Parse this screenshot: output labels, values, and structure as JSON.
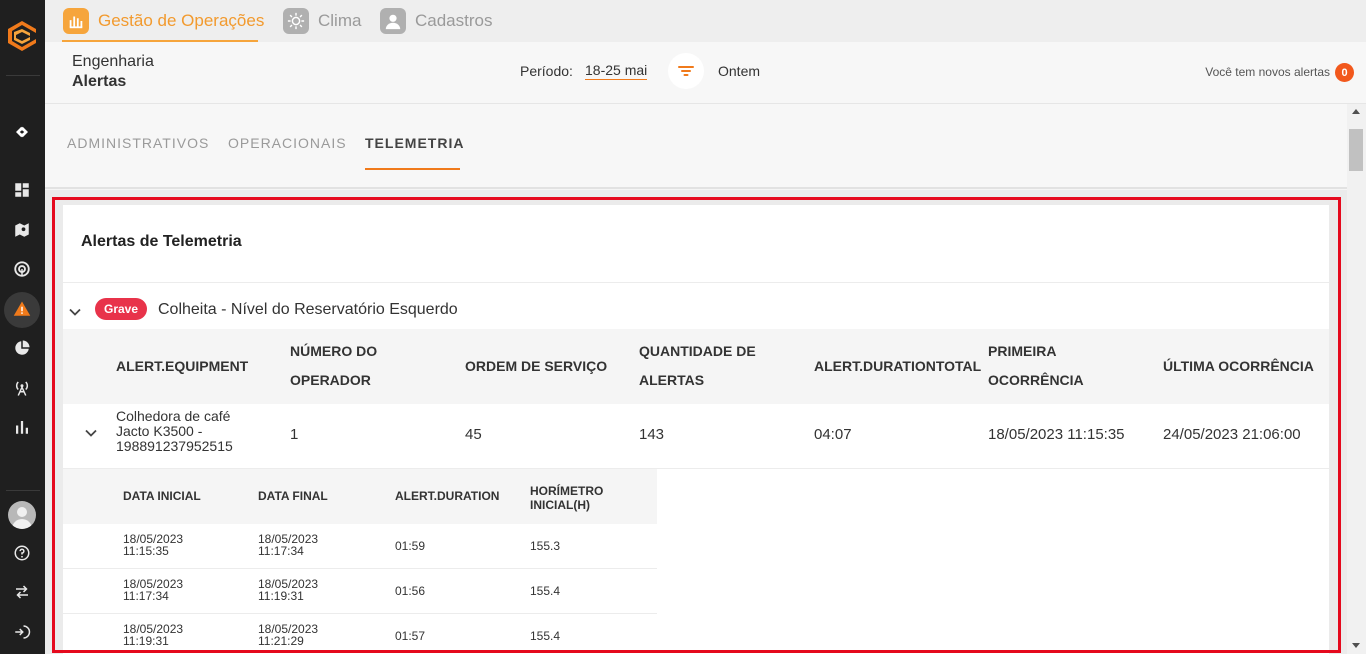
{
  "topnav": {
    "tabs": [
      {
        "label": "Gestão de Operações",
        "icon": "operations-icon",
        "active": true
      },
      {
        "label": "Clima",
        "icon": "sun-icon",
        "active": false
      },
      {
        "label": "Cadastros",
        "icon": "user-icon",
        "active": false
      }
    ]
  },
  "header": {
    "breadcrumb": "Engenharia",
    "title": "Alertas",
    "period_label": "Período:",
    "period_value": "18-25 mai",
    "filter_icon": "filter-icon",
    "quick_filter": "Ontem",
    "alerts_message": "Você tem novos alertas",
    "alerts_count": "0"
  },
  "subtabs": [
    "ADMINISTRATIVOS",
    "OPERACIONAIS",
    "TELEMETRIA"
  ],
  "card": {
    "title": "Alertas de Telemetria",
    "group": {
      "severity": "Grave",
      "title": "Colheita - Nível do Reservatório Esquerdo"
    },
    "columns": [
      "ALERT.EQUIPMENT",
      "NÚMERO DO OPERADOR",
      "ORDEM DE SERVIÇO",
      "QUANTIDADE DE ALERTAS",
      "ALERT.DURATIONTOTAL",
      "PRIMEIRA OCORRÊNCIA",
      "ÚLTIMA OCORRÊNCIA"
    ],
    "row": {
      "equipment": "Colhedora de café Jacto K3500 - 198891237952515",
      "operator": "1",
      "service_order": "45",
      "alert_count": "143",
      "duration_total": "04:07",
      "first": "18/05/2023 11:15:35",
      "last": "24/05/2023 21:06:00"
    },
    "sub_columns": [
      "DATA INICIAL",
      "DATA FINAL",
      "ALERT.DURATION",
      "HORÍMETRO INICIAL(H)"
    ],
    "sub_rows": [
      {
        "start_date": "18/05/2023",
        "start_time": "11:15:35",
        "end_date": "18/05/2023",
        "end_time": "11:17:34",
        "duration": "01:59",
        "hourmeter": "155.3"
      },
      {
        "start_date": "18/05/2023",
        "start_time": "11:17:34",
        "end_date": "18/05/2023",
        "end_time": "11:19:31",
        "duration": "01:56",
        "hourmeter": "155.4"
      },
      {
        "start_date": "18/05/2023",
        "start_time": "11:19:31",
        "end_date": "18/05/2023",
        "end_time": "11:21:29",
        "duration": "01:57",
        "hourmeter": "155.4"
      }
    ]
  },
  "sidebar": {
    "icons": [
      "logo-icon",
      "integration-icon",
      "dashboard-icon",
      "map-icon",
      "signal-icon",
      "alert-icon",
      "pie-chart-icon",
      "antenna-icon",
      "bar-chart-icon",
      "avatar",
      "help-icon",
      "swap-icon",
      "logout-icon"
    ]
  }
}
